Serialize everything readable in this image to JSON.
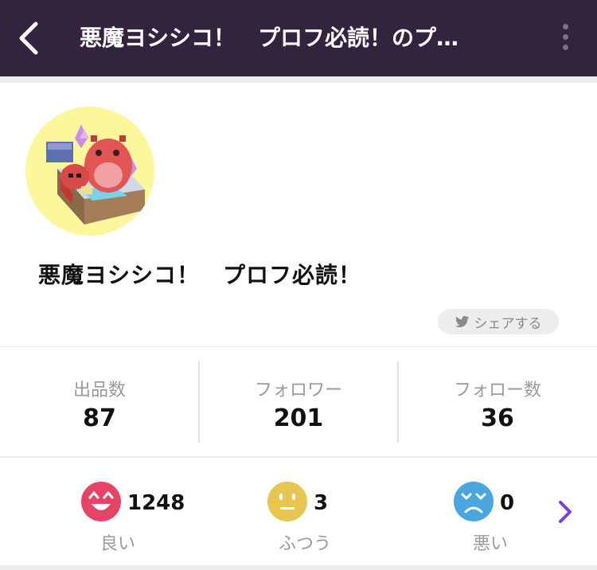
{
  "header": {
    "title": "悪魔ヨシシコ！　プロフ必読！のプ…",
    "back_icon": "chevron-left-icon",
    "more_icon": "more-vertical-icon"
  },
  "profile": {
    "name": "悪魔ヨシシコ！　プロフ必読！",
    "share_label": "シェアする",
    "share_icon": "twitter-bird-icon"
  },
  "stats": [
    {
      "label": "出品数",
      "value": "87"
    },
    {
      "label": "フォロワー",
      "value": "201"
    },
    {
      "label": "フォロー数",
      "value": "36"
    }
  ],
  "ratings": [
    {
      "label": "良い",
      "count": "1248",
      "icon": "happy-face-icon",
      "color": "#e64366"
    },
    {
      "label": "ふつう",
      "count": "3",
      "icon": "neutral-face-icon",
      "color": "#e6c650"
    },
    {
      "label": "悪い",
      "count": "0",
      "icon": "sad-face-icon",
      "color": "#4aa6df"
    }
  ],
  "colors": {
    "header_bg": "#33233f",
    "accent_purple": "#7b3fe4"
  }
}
